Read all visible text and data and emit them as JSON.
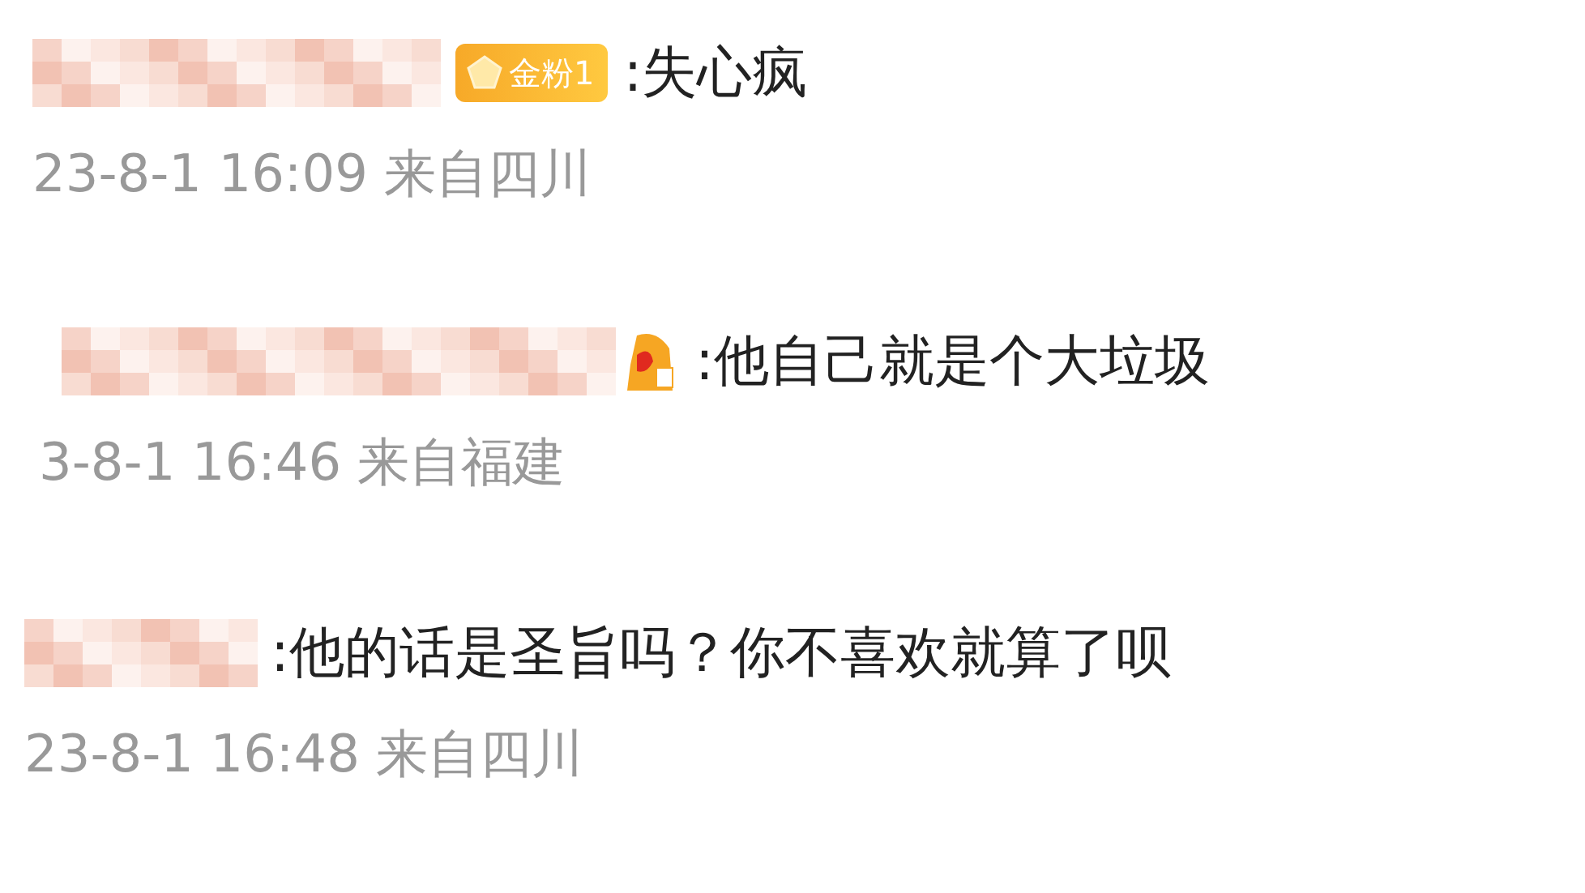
{
  "comments": [
    {
      "badge": {
        "kind": "label",
        "text": "金粉1"
      },
      "text": ":失心疯",
      "time": "23-8-1 16:09 来自四川"
    },
    {
      "badge": {
        "kind": "icon"
      },
      "text": ":他自己就是个大垃圾",
      "time": "3-8-1 16:46 来自福建"
    },
    {
      "text": ":他的话是圣旨吗？你不喜欢就算了呗",
      "time": "23-8-1 16:48 来自四川"
    }
  ]
}
